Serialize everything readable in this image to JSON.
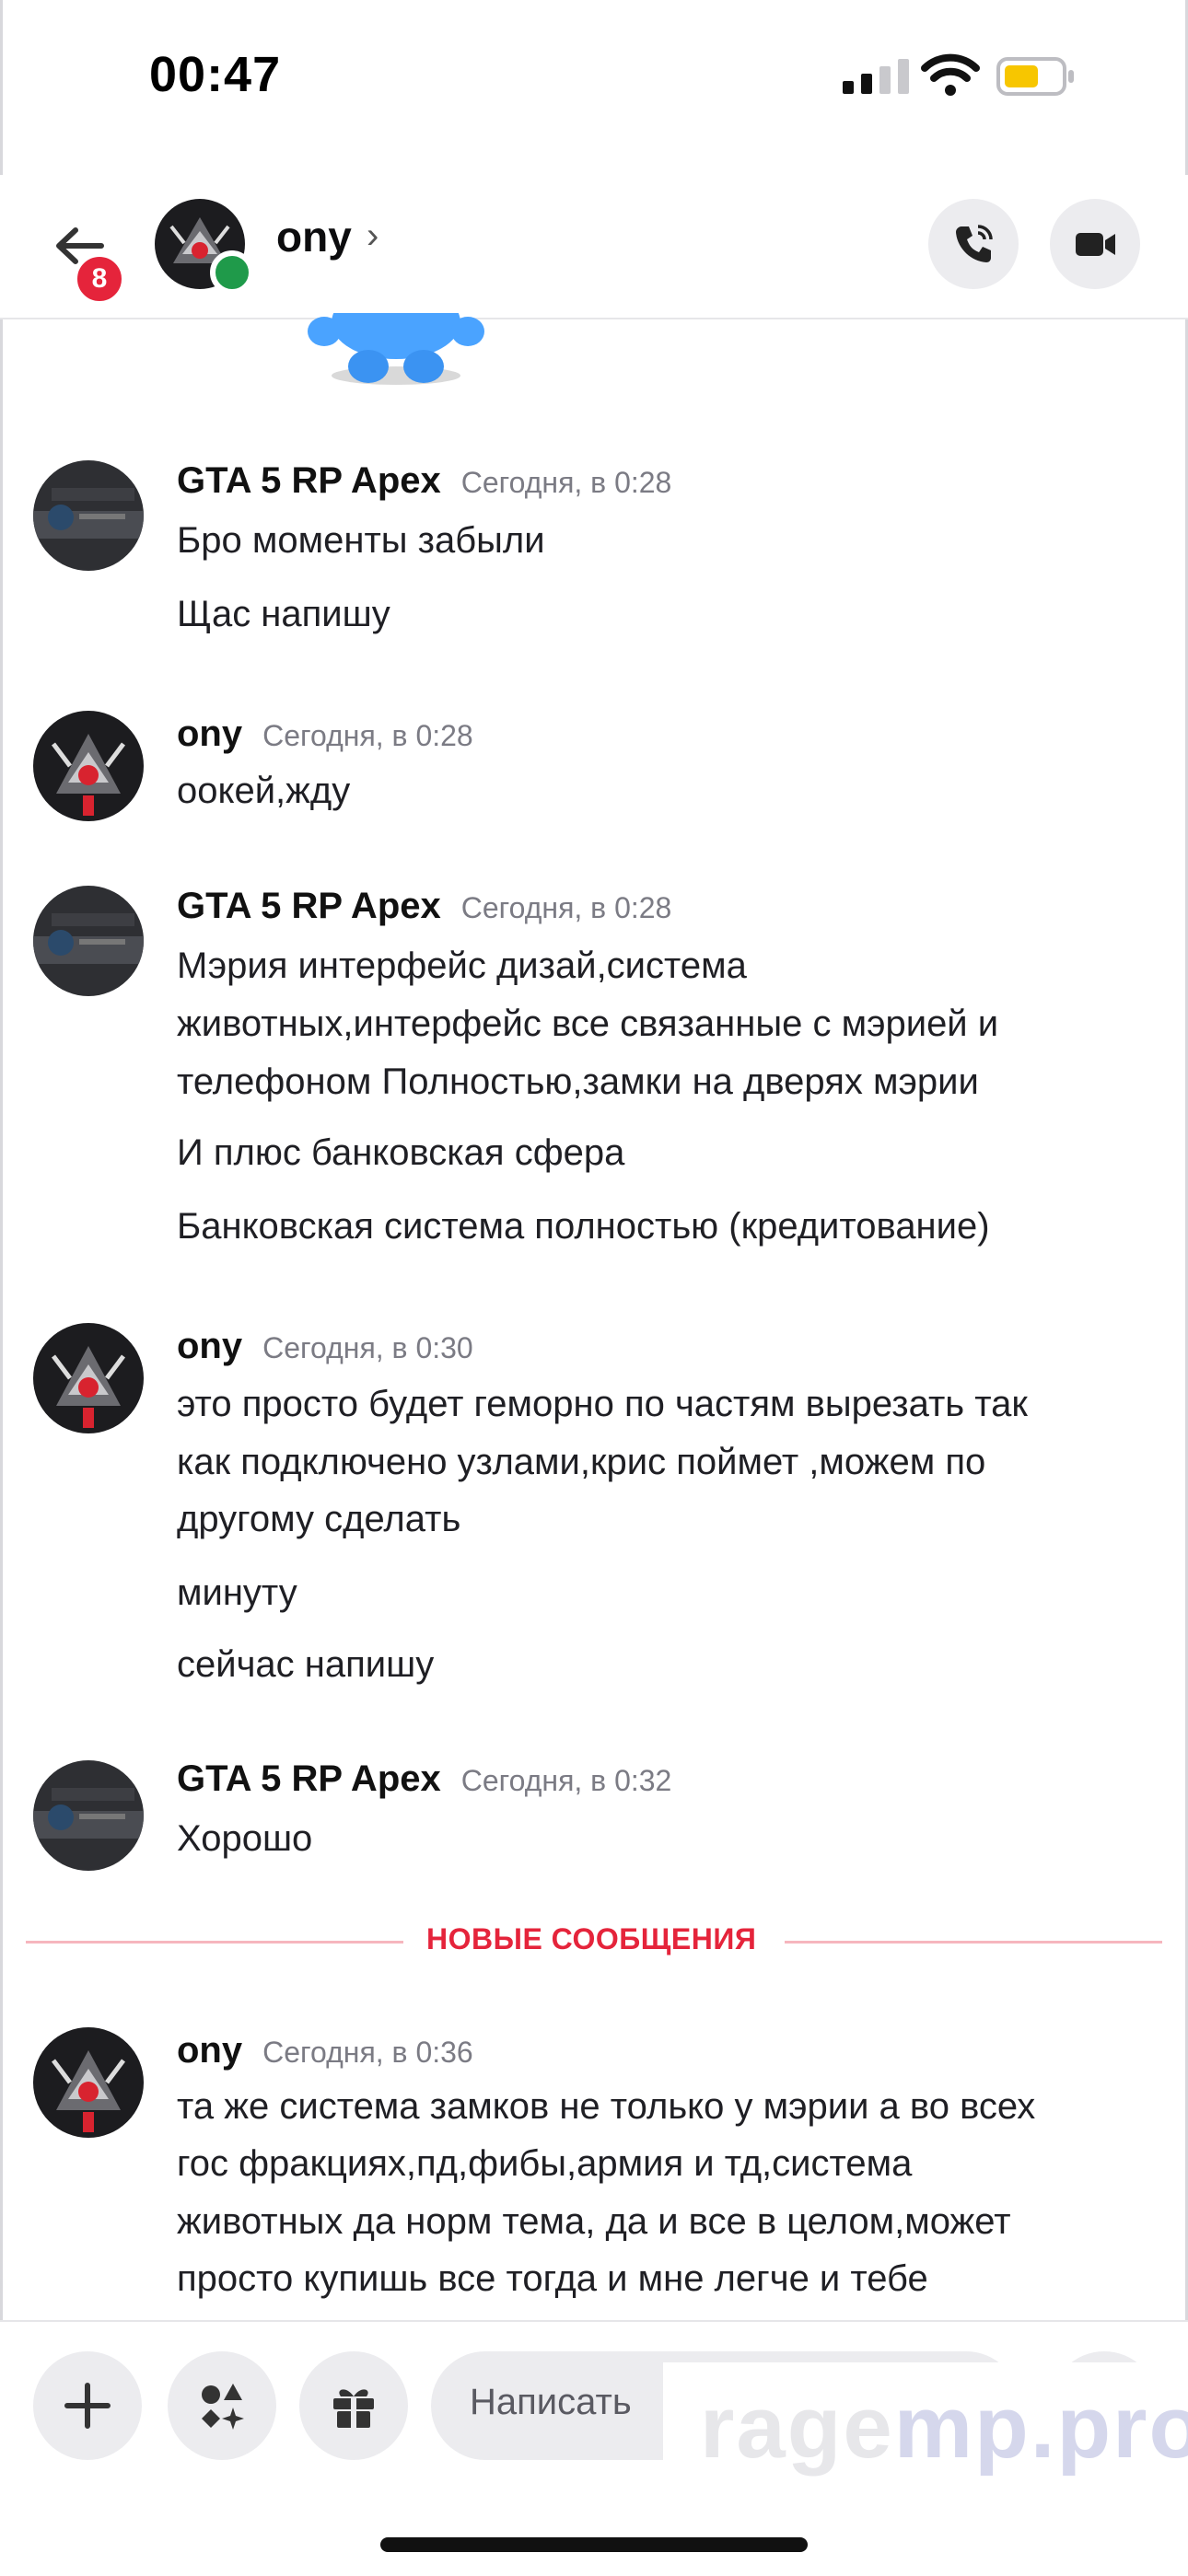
{
  "status_bar": {
    "time": "00:47"
  },
  "header": {
    "back_badge": "8",
    "contact_name": "ony",
    "chevron": "›",
    "online": true
  },
  "messages": [
    {
      "author": "GTA 5 RP  Apex",
      "time": "Сегодня, в 0:28",
      "lines": [
        "Бро моменты забыли",
        "Щас напишу"
      ]
    },
    {
      "author": "ony",
      "time": "Сегодня, в 0:28",
      "lines": [
        "оокей,жду"
      ]
    },
    {
      "author": "GTA 5 RP  Apex",
      "time": "Сегодня, в 0:28",
      "lines": [
        "Мэрия интерфейс дизай,система",
        "животных,интерфейс все связанные с мэрией и",
        "телефоном Полностью,замки на дверях мэрии",
        "И плюс банковская сфера",
        "Банковская система полностью (кредитование)"
      ]
    },
    {
      "author": "ony",
      "time": "Сегодня, в 0:30",
      "lines": [
        "это просто будет геморно по частям вырезать так",
        "как подключено узлами,крис поймет ,можем по",
        "другому сделать",
        "минуту",
        "сейчас напишу"
      ]
    },
    {
      "author": "GTA 5 RP  Apex",
      "time": "Сегодня, в 0:32",
      "lines": [
        "Хорошо"
      ]
    },
    {
      "author": "ony",
      "time": "Сегодня, в 0:36",
      "lines": [
        "та же система замков не только у мэрии а во всех",
        "гос фракциях,пд,фибы,армия и тд,система",
        "животных да норм тема, да и все в целом,может",
        "просто купишь все тогда и мне легче и тебе"
      ]
    }
  ],
  "new_messages_divider": "НОВЫЕ СООБЩЕНИЯ",
  "composer": {
    "placeholder": "Написать"
  },
  "watermark": {
    "part1": "rage",
    "part2": "mp.pro"
  },
  "colors": {
    "accent_red": "#e5243b",
    "online_green": "#1f9a4a",
    "divider_pink": "#f6b6be"
  }
}
